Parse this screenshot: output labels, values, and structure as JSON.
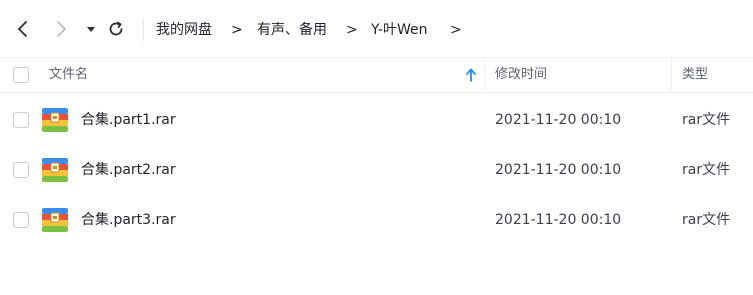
{
  "breadcrumb": {
    "items": [
      "我的网盘",
      "有声、备用",
      "Y-叶Wen"
    ],
    "separator": ">"
  },
  "toolbar": {
    "icons": [
      "back-icon",
      "forward-icon",
      "history-dropdown-icon",
      "refresh-icon"
    ]
  },
  "columns": {
    "name": "文件名",
    "modified": "修改时间",
    "type": "类型",
    "sort_icon": "sort-ascending-icon"
  },
  "files": [
    {
      "name": "合集.part1.rar",
      "modified": "2021-11-20 00:10",
      "type": "rar文件",
      "icon": "rar-archive-icon"
    },
    {
      "name": "合集.part2.rar",
      "modified": "2021-11-20 00:10",
      "type": "rar文件",
      "icon": "rar-archive-icon"
    },
    {
      "name": "合集.part3.rar",
      "modified": "2021-11-20 00:10",
      "type": "rar文件",
      "icon": "rar-archive-icon"
    }
  ],
  "colors": {
    "accent": "#1e90ff",
    "text": "#1f2329",
    "muted": "#5d6470",
    "rar_red": "#e8513a",
    "rar_blue": "#3b8cf0",
    "rar_yellow": "#f6c23a",
    "rar_green": "#7cc043"
  }
}
